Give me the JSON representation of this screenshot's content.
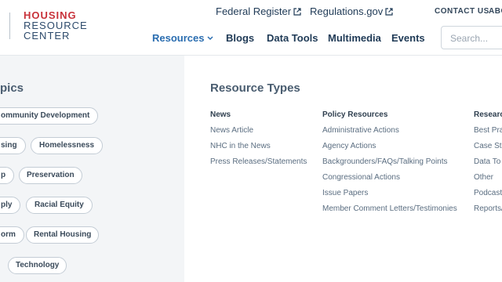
{
  "header": {
    "logo": {
      "line1": "HOUSING",
      "line2": "RESOURCE",
      "line3": "CENTER"
    },
    "external_links": [
      {
        "label": "Federal Register",
        "icon": "external-link-icon"
      },
      {
        "label": "Regulations.gov",
        "icon": "external-link-icon"
      }
    ],
    "utility_links": [
      "CONTACT US",
      "ABO"
    ],
    "nav": [
      {
        "label": "Resources",
        "icon": "chevron-down-icon",
        "active": true
      },
      {
        "label": "Blogs"
      },
      {
        "label": "Data Tools"
      },
      {
        "label": "Multimedia"
      },
      {
        "label": "Events"
      }
    ],
    "search": {
      "placeholder": "Search..."
    }
  },
  "topics": {
    "title": "pics",
    "items": [
      "ommunity Development",
      "sing",
      "Homelessness",
      "p",
      "Preservation",
      "ply",
      "Racial Equity",
      "orm",
      "Rental Housing",
      "Technology"
    ]
  },
  "resource_types": {
    "title": "Resource Types",
    "columns": [
      {
        "heading": "News",
        "links": [
          "News Article",
          "NHC in the News",
          "Press Releases/Statements"
        ]
      },
      {
        "heading": "Policy Resources",
        "links": [
          "Administrative Actions",
          "Agency Actions",
          "Backgrounders/FAQs/Talking Points",
          "Congressional Actions",
          "Issue Papers",
          "Member Comment Letters/Testimonies"
        ]
      },
      {
        "heading": "Researc",
        "links": [
          "Best Pra",
          "Case St",
          "Data To",
          "Other",
          "Podcast",
          "Reports/"
        ]
      }
    ]
  },
  "colors": {
    "brand_red": "#c8323a",
    "brand_navy": "#2d4a6b",
    "nav_active": "#2a6db0",
    "panel_gray": "#f3f5f7"
  }
}
